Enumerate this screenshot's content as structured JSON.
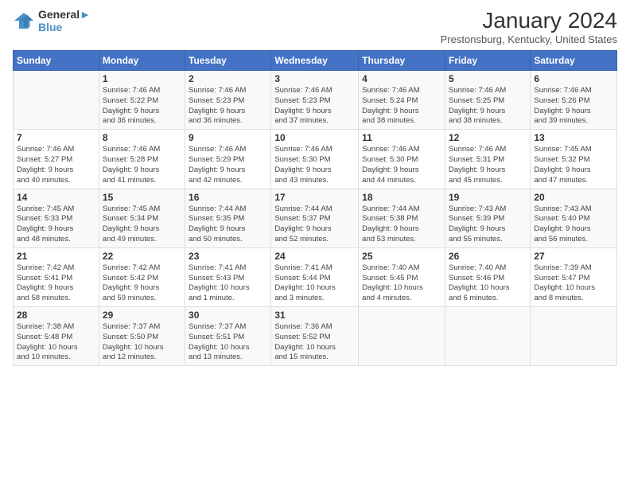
{
  "header": {
    "logo_line1": "General",
    "logo_line2": "Blue",
    "month_title": "January 2024",
    "location": "Prestonsburg, Kentucky, United States"
  },
  "weekdays": [
    "Sunday",
    "Monday",
    "Tuesday",
    "Wednesday",
    "Thursday",
    "Friday",
    "Saturday"
  ],
  "weeks": [
    [
      {
        "num": "",
        "info": ""
      },
      {
        "num": "1",
        "info": "Sunrise: 7:46 AM\nSunset: 5:22 PM\nDaylight: 9 hours\nand 36 minutes."
      },
      {
        "num": "2",
        "info": "Sunrise: 7:46 AM\nSunset: 5:23 PM\nDaylight: 9 hours\nand 36 minutes."
      },
      {
        "num": "3",
        "info": "Sunrise: 7:46 AM\nSunset: 5:23 PM\nDaylight: 9 hours\nand 37 minutes."
      },
      {
        "num": "4",
        "info": "Sunrise: 7:46 AM\nSunset: 5:24 PM\nDaylight: 9 hours\nand 38 minutes."
      },
      {
        "num": "5",
        "info": "Sunrise: 7:46 AM\nSunset: 5:25 PM\nDaylight: 9 hours\nand 38 minutes."
      },
      {
        "num": "6",
        "info": "Sunrise: 7:46 AM\nSunset: 5:26 PM\nDaylight: 9 hours\nand 39 minutes."
      }
    ],
    [
      {
        "num": "7",
        "info": "Sunrise: 7:46 AM\nSunset: 5:27 PM\nDaylight: 9 hours\nand 40 minutes."
      },
      {
        "num": "8",
        "info": "Sunrise: 7:46 AM\nSunset: 5:28 PM\nDaylight: 9 hours\nand 41 minutes."
      },
      {
        "num": "9",
        "info": "Sunrise: 7:46 AM\nSunset: 5:29 PM\nDaylight: 9 hours\nand 42 minutes."
      },
      {
        "num": "10",
        "info": "Sunrise: 7:46 AM\nSunset: 5:30 PM\nDaylight: 9 hours\nand 43 minutes."
      },
      {
        "num": "11",
        "info": "Sunrise: 7:46 AM\nSunset: 5:30 PM\nDaylight: 9 hours\nand 44 minutes."
      },
      {
        "num": "12",
        "info": "Sunrise: 7:46 AM\nSunset: 5:31 PM\nDaylight: 9 hours\nand 45 minutes."
      },
      {
        "num": "13",
        "info": "Sunrise: 7:45 AM\nSunset: 5:32 PM\nDaylight: 9 hours\nand 47 minutes."
      }
    ],
    [
      {
        "num": "14",
        "info": "Sunrise: 7:45 AM\nSunset: 5:33 PM\nDaylight: 9 hours\nand 48 minutes."
      },
      {
        "num": "15",
        "info": "Sunrise: 7:45 AM\nSunset: 5:34 PM\nDaylight: 9 hours\nand 49 minutes."
      },
      {
        "num": "16",
        "info": "Sunrise: 7:44 AM\nSunset: 5:35 PM\nDaylight: 9 hours\nand 50 minutes."
      },
      {
        "num": "17",
        "info": "Sunrise: 7:44 AM\nSunset: 5:37 PM\nDaylight: 9 hours\nand 52 minutes."
      },
      {
        "num": "18",
        "info": "Sunrise: 7:44 AM\nSunset: 5:38 PM\nDaylight: 9 hours\nand 53 minutes."
      },
      {
        "num": "19",
        "info": "Sunrise: 7:43 AM\nSunset: 5:39 PM\nDaylight: 9 hours\nand 55 minutes."
      },
      {
        "num": "20",
        "info": "Sunrise: 7:43 AM\nSunset: 5:40 PM\nDaylight: 9 hours\nand 56 minutes."
      }
    ],
    [
      {
        "num": "21",
        "info": "Sunrise: 7:42 AM\nSunset: 5:41 PM\nDaylight: 9 hours\nand 58 minutes."
      },
      {
        "num": "22",
        "info": "Sunrise: 7:42 AM\nSunset: 5:42 PM\nDaylight: 9 hours\nand 59 minutes."
      },
      {
        "num": "23",
        "info": "Sunrise: 7:41 AM\nSunset: 5:43 PM\nDaylight: 10 hours\nand 1 minute."
      },
      {
        "num": "24",
        "info": "Sunrise: 7:41 AM\nSunset: 5:44 PM\nDaylight: 10 hours\nand 3 minutes."
      },
      {
        "num": "25",
        "info": "Sunrise: 7:40 AM\nSunset: 5:45 PM\nDaylight: 10 hours\nand 4 minutes."
      },
      {
        "num": "26",
        "info": "Sunrise: 7:40 AM\nSunset: 5:46 PM\nDaylight: 10 hours\nand 6 minutes."
      },
      {
        "num": "27",
        "info": "Sunrise: 7:39 AM\nSunset: 5:47 PM\nDaylight: 10 hours\nand 8 minutes."
      }
    ],
    [
      {
        "num": "28",
        "info": "Sunrise: 7:38 AM\nSunset: 5:48 PM\nDaylight: 10 hours\nand 10 minutes."
      },
      {
        "num": "29",
        "info": "Sunrise: 7:37 AM\nSunset: 5:50 PM\nDaylight: 10 hours\nand 12 minutes."
      },
      {
        "num": "30",
        "info": "Sunrise: 7:37 AM\nSunset: 5:51 PM\nDaylight: 10 hours\nand 13 minutes."
      },
      {
        "num": "31",
        "info": "Sunrise: 7:36 AM\nSunset: 5:52 PM\nDaylight: 10 hours\nand 15 minutes."
      },
      {
        "num": "",
        "info": ""
      },
      {
        "num": "",
        "info": ""
      },
      {
        "num": "",
        "info": ""
      }
    ]
  ]
}
